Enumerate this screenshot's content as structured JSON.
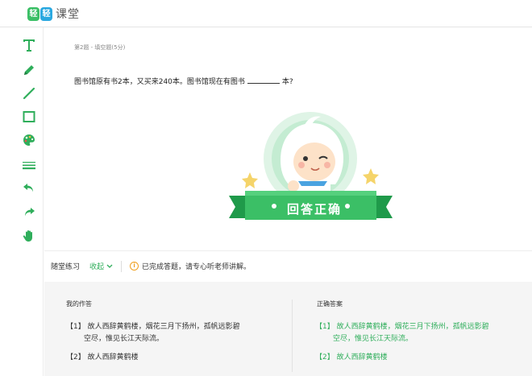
{
  "header": {
    "logo_chars": [
      "轻",
      "轻"
    ],
    "app_name": "课堂",
    "brand_colors": {
      "green": "#3bbf66",
      "blue": "#2aa8e0"
    }
  },
  "toolbar": {
    "tools": [
      "text-tool-icon",
      "pencil-icon",
      "line-icon",
      "rectangle-icon",
      "palette-icon",
      "line-width-icon",
      "undo-icon",
      "redo-icon",
      "hand-icon"
    ],
    "accent": "#2fae5b"
  },
  "question": {
    "meta": "第2题 - 填空题(5分)",
    "text_before": "图书馆原有书2本，又买来240本。图书馆现在有图书",
    "text_after": "本?"
  },
  "result_badge": {
    "label": "回答正确"
  },
  "status": {
    "title": "随堂练习",
    "collapse_label": "收起",
    "info_symbol": "i",
    "message": "已完成答题，请专心听老师讲解。"
  },
  "answers": {
    "mine_title": "我的作答",
    "correct_title": "正确答案",
    "mine": [
      {
        "index": "【1】",
        "text": "故人西辞黄鹤楼，烟花三月下扬州，孤帆远影碧",
        "cont": "空尽，惟见长江天际流。"
      },
      {
        "index": "【2】",
        "text": "故人西辞黄鹤楼"
      }
    ],
    "correct": [
      {
        "index": "【1】",
        "text": "故人西辞黄鹤楼，烟花三月下扬州，孤帆远影碧",
        "cont": "空尽，惟见长江天际流。"
      },
      {
        "index": "【2】",
        "text": "故人西辞黄鹤楼"
      }
    ]
  }
}
